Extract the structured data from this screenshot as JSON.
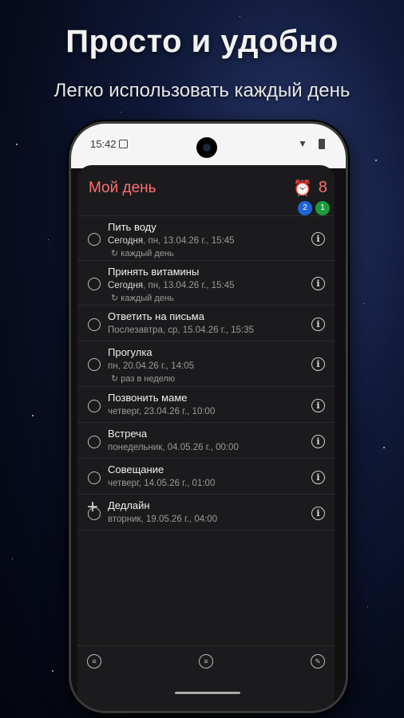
{
  "promo": {
    "headline": "Просто и удобно",
    "subline": "Легко использовать каждый день"
  },
  "status_bar": {
    "time": "15:42"
  },
  "app": {
    "title": "Мой день",
    "alarm_icon": "alarm-clock-icon",
    "count": "8",
    "badge_blue": "2",
    "badge_green": "1",
    "colors": {
      "accent": "#ff6f6f",
      "badge_blue": "#1e64d8",
      "badge_green": "#1e9a3c",
      "background": "#1b1b1d"
    }
  },
  "tasks": [
    {
      "title": "Пить воду",
      "date_bold": "Сегодня",
      "date_rest": ", пн, 13.04.26 г., 15:45",
      "repeat": "каждый день"
    },
    {
      "title": "Принять витамины",
      "date_bold": "Сегодня",
      "date_rest": ", пн, 13.04.26 г., 15:45",
      "repeat": "каждый день"
    },
    {
      "title": "Ответить на письма",
      "date_bold": "",
      "date_rest": "Послезавтра, ср, 15.04.26 г., 15:35",
      "repeat": ""
    },
    {
      "title": "Прогулка",
      "date_bold": "",
      "date_rest": "пн, 20.04.26 г., 14:05",
      "repeat": "раз в неделю"
    },
    {
      "title": "Позвонить маме",
      "date_bold": "",
      "date_rest": "четверг, 23.04.26 г., 10:00",
      "repeat": ""
    },
    {
      "title": "Встреча",
      "date_bold": "",
      "date_rest": "понедельник, 04.05.26 г., 00:00",
      "repeat": ""
    },
    {
      "title": "Совещание",
      "date_bold": "",
      "date_rest": "четверг, 14.05.26 г., 01:00",
      "repeat": ""
    },
    {
      "title": "Дедлайн",
      "date_bold": "",
      "date_rest": "вторник, 19.05.26 г., 04:00",
      "repeat": ""
    }
  ],
  "add_button": "+",
  "bottom_bar": {
    "left_icon": "sort-icon",
    "center_icon": "menu-icon",
    "right_icon": "edit-icon"
  }
}
